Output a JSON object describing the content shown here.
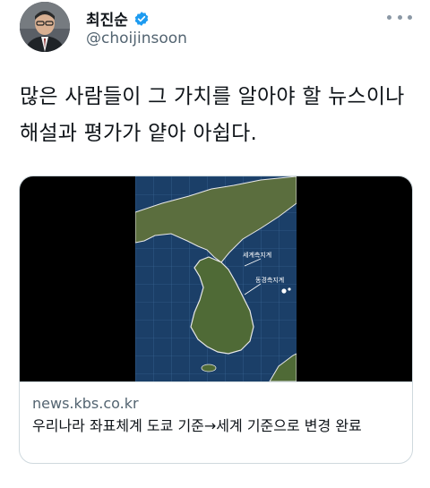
{
  "author": {
    "display_name": "최진순",
    "handle": "@choijinsoon"
  },
  "tweet": {
    "text": "많은 사람들이 그 가치를 알아야 할 뉴스이나 해설과 평가가 얕아 아쉽다."
  },
  "card": {
    "domain": "news.kbs.co.kr",
    "title": "우리나라 좌표체계 도쿄 기준→세계 기준으로 변경 완료",
    "media_labels": {
      "world": "세계측지계",
      "tokyo": "동경측지계"
    }
  },
  "icons": {
    "verified": "verified-badge-icon",
    "more": "more-options-icon"
  },
  "colors": {
    "verified_blue": "#1d9bf0",
    "secondary_text": "#536471",
    "border": "#cfd9de"
  }
}
